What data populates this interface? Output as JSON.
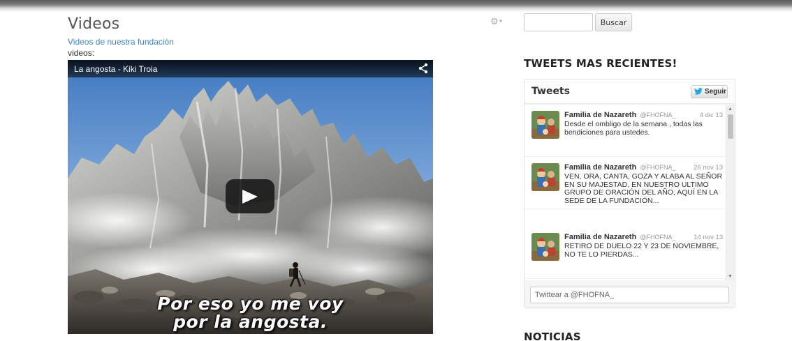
{
  "page": {
    "title": "Videos",
    "subtitle_link": "Videos de nuestra fundación",
    "field_label": "videos:"
  },
  "video": {
    "title": "La angosta - Kiki Troia",
    "caption_line1": "Por eso yo me voy",
    "caption_line2": "por la angosta."
  },
  "sidebar": {
    "search_button": "Buscar",
    "tweets_section_title": "TWEETS MAS RECIENTES!",
    "news_section_title": "NOTICIAS"
  },
  "twitter": {
    "widget_title": "Tweets",
    "follow_label": "Seguir",
    "compose_placeholder": "Twittear a @FHOFNA_",
    "tweets": [
      {
        "author": "Familia de Nazareth",
        "handle": "@FHOFNA_",
        "date": "4 dic 13",
        "text": "Desde el ombligo de la semana , todas las bendiciones para ustedes."
      },
      {
        "author": "Familia de Nazareth",
        "handle": "@FHOFNA_",
        "date": "26 nov 13",
        "text": "VEN, ORA, CANTA, GOZA Y ALABA AL SEÑOR EN SU MAJESTAD, EN NUESTRO ULTIMO GRUPO DE ORACIÓN DEL AÑO, AQUÍ EN LA SEDE DE LA FUNDACIÓN..."
      },
      {
        "author": "Familia de Nazareth",
        "handle": "@FHOFNA_",
        "date": "14 nov 13",
        "text": "RETIRO DE DUELO 22 Y 23 DE NOVIEMBRE, NO TE LO PIERDAS..."
      }
    ]
  },
  "colors": {
    "link": "#3d85c6",
    "twitter_blue": "#2aa9e0"
  },
  "icons": {
    "gear": "gear-icon",
    "share": "share-icon",
    "play": "play-icon",
    "twitter_bird": "twitter-bird-icon"
  }
}
